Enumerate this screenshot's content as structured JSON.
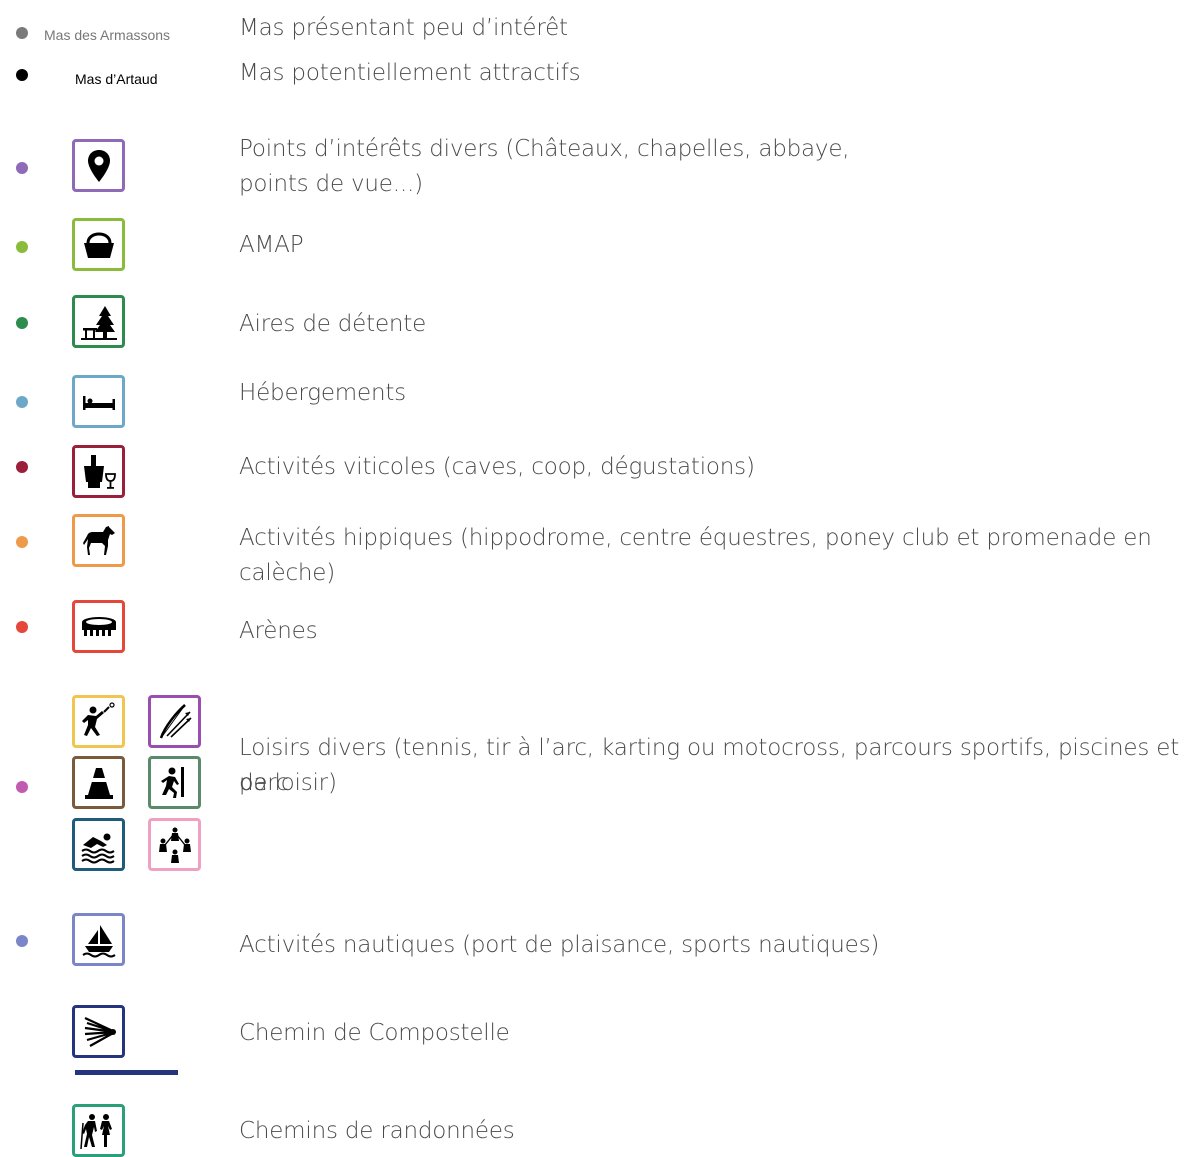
{
  "legend": {
    "mas_low": {
      "name": "Mas des Armassons",
      "label": "Mas présentant peu d’intérêt",
      "dot_color": "#7a7a7a"
    },
    "mas_high": {
      "name": "Mas d’Artaud",
      "label": "Mas potentiellement attractifs",
      "dot_color": "#000000"
    },
    "interest": {
      "label_line1": "Points d’intérêts divers (Châteaux, chapelles, abbaye,",
      "label_line2": "points de vue...)",
      "color": "#8e6ab8",
      "icon": "map-pin-icon"
    },
    "amap": {
      "label": "AMAP",
      "color": "#8bbb3c",
      "icon": "basket-icon"
    },
    "rest": {
      "label": "Aires de détente",
      "color": "#2e8b4e",
      "icon": "picnic-tree-icon"
    },
    "lodging": {
      "label": "Hébergements",
      "color": "#6ea8c9",
      "icon": "bed-icon"
    },
    "wine": {
      "label": "Activités viticoles (caves, coop, dégustations)",
      "color": "#9a1f3a",
      "icon": "wine-icon"
    },
    "horse": {
      "label_line1": "Activités hippiques (hippodrome, centre équestres, poney club et promenade en",
      "label_line2": "calèche)",
      "color": "#ee9a4a",
      "icon": "horse-icon"
    },
    "arena": {
      "label": "Arènes",
      "color": "#e5473a",
      "icon": "arena-icon"
    },
    "leisure": {
      "label_line1": "Loisirs divers (tennis, tir à l’arc, karting ou motocross, parcours sportifs, piscines et parc",
      "label_line2": "de loisir)",
      "color": "#c15bb0",
      "icons": [
        {
          "icon": "tennis-icon",
          "color": "#f0c650"
        },
        {
          "icon": "archery-icon",
          "color": "#9a4fb0"
        },
        {
          "icon": "cone-icon",
          "color": "#7a5a3a"
        },
        {
          "icon": "running-icon",
          "color": "#5a8a6a"
        },
        {
          "icon": "swimming-icon",
          "color": "#1f5b7a"
        },
        {
          "icon": "playground-icon",
          "color": "#f0a0c0"
        }
      ]
    },
    "nautical": {
      "label": "Activités nautiques (port de plaisance, sports nautiques)",
      "color": "#7b86c8",
      "icon": "sailboat-icon"
    },
    "compostelle": {
      "label": "Chemin de Compostelle",
      "color": "#24357d",
      "icon": "scallop-shell-icon"
    },
    "hiking": {
      "label": "Chemins de randonnées",
      "color": "#2aa07a",
      "icon": "hikers-icon"
    }
  }
}
